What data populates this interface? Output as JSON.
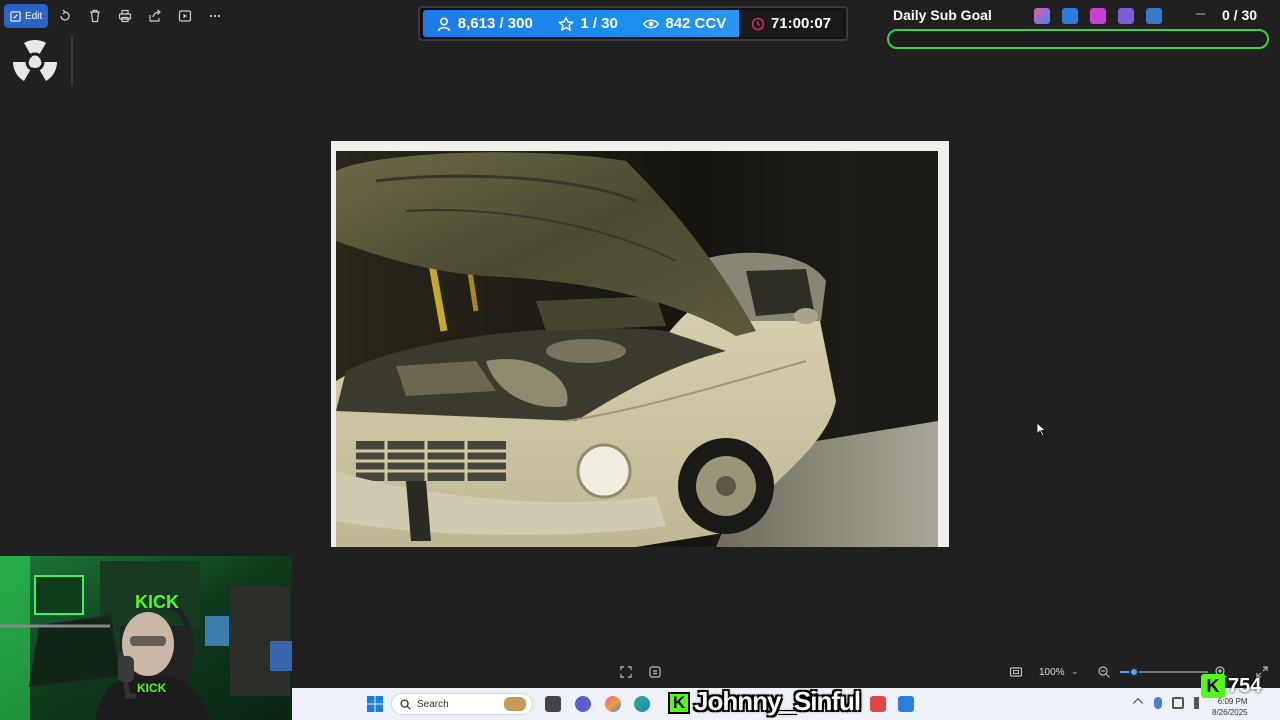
{
  "toolbar": {
    "edit_label": "Edit",
    "icons": [
      "rotate-icon",
      "delete-icon",
      "print-icon",
      "share-icon",
      "slideshow-icon",
      "more-icon"
    ]
  },
  "stats": {
    "followers": "8,613 / 300",
    "stars": "1 / 30",
    "viewers": "842 CCV",
    "timer": "71:00:07"
  },
  "goal": {
    "title": "Daily Sub Goal",
    "count": "0 / 30",
    "progress": 0
  },
  "viewer": {
    "zoom": "100%"
  },
  "taskbar": {
    "search_placeholder": "Search",
    "clock_time": "6:09 PM",
    "clock_date": "8/26/2025"
  },
  "overlay": {
    "username": "Johnny_Sinful",
    "kick_letter": "K",
    "viewer_count": "754"
  },
  "webcam": {
    "sign": "KICK",
    "shirt": "KICK"
  },
  "colors": {
    "accent_blue": "#1a8df0",
    "kick_green": "#53fc18",
    "goal_border": "#3ad14a",
    "edit_button": "#2b64c8"
  }
}
